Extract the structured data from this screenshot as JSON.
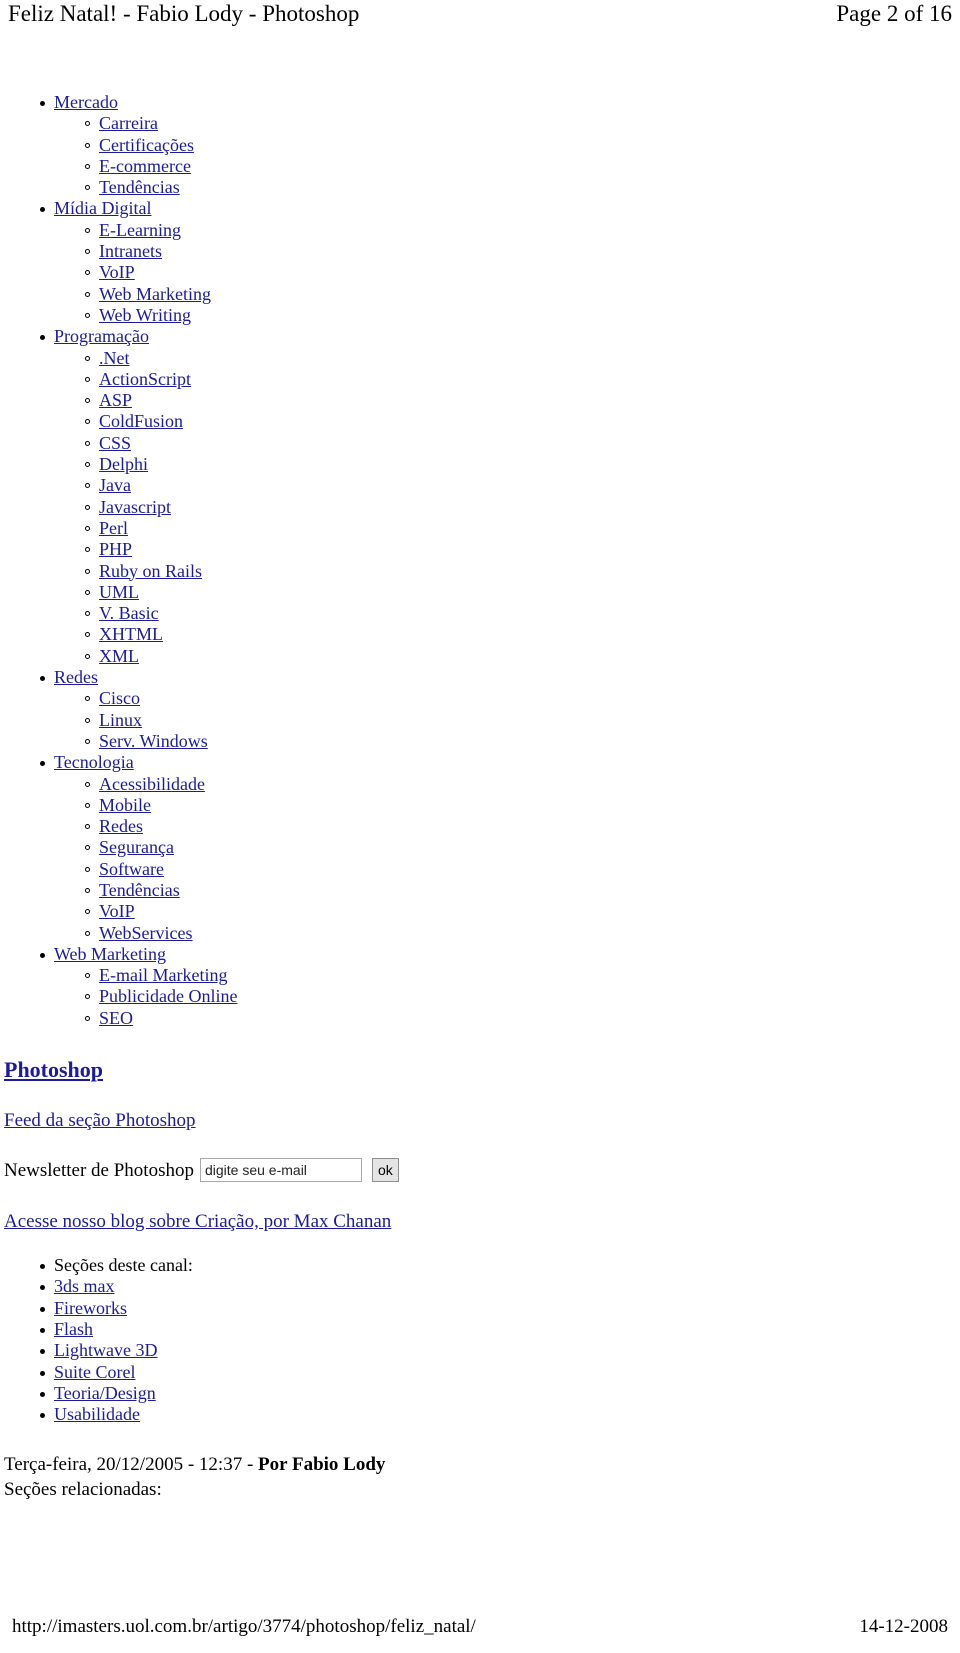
{
  "header": {
    "title": "Feliz Natal! - Fabio Lody - Photoshop",
    "page_indicator": "Page 2 of 16"
  },
  "nav": {
    "groups": [
      {
        "label": "Mercado",
        "children": [
          {
            "label": "Carreira"
          },
          {
            "label": "Certificações"
          },
          {
            "label": "E-commerce"
          },
          {
            "label": "Tendências"
          }
        ]
      },
      {
        "label": "Mídia Digital",
        "children": [
          {
            "label": "E-Learning"
          },
          {
            "label": "Intranets"
          },
          {
            "label": "VoIP"
          },
          {
            "label": "Web Marketing"
          },
          {
            "label": "Web Writing"
          }
        ]
      },
      {
        "label": "Programação",
        "children": [
          {
            "label": ".Net"
          },
          {
            "label": "ActionScript"
          },
          {
            "label": "ASP"
          },
          {
            "label": "ColdFusion"
          },
          {
            "label": "CSS"
          },
          {
            "label": "Delphi"
          },
          {
            "label": "Java"
          },
          {
            "label": "Javascript"
          },
          {
            "label": "Perl"
          },
          {
            "label": "PHP"
          },
          {
            "label": "Ruby on Rails"
          },
          {
            "label": "UML"
          },
          {
            "label": "V. Basic"
          },
          {
            "label": "XHTML"
          },
          {
            "label": "XML"
          }
        ]
      },
      {
        "label": "Redes",
        "children": [
          {
            "label": "Cisco"
          },
          {
            "label": "Linux"
          },
          {
            "label": "Serv. Windows"
          }
        ]
      },
      {
        "label": "Tecnologia",
        "children": [
          {
            "label": "Acessibilidade"
          },
          {
            "label": "Mobile"
          },
          {
            "label": "Redes"
          },
          {
            "label": "Segurança"
          },
          {
            "label": "Software"
          },
          {
            "label": "Tendências"
          },
          {
            "label": "VoIP"
          },
          {
            "label": "WebServices"
          }
        ]
      },
      {
        "label": "Web Marketing",
        "children": [
          {
            "label": "E-mail Marketing"
          },
          {
            "label": "Publicidade Online"
          },
          {
            "label": "SEO"
          }
        ]
      }
    ]
  },
  "section": {
    "heading": "Photoshop",
    "feed_link": "Feed da seção Photoshop"
  },
  "newsletter": {
    "label": "Newsletter de Photoshop",
    "input_value": "digite seu e-mail",
    "input_placeholder": "digite seu e-mail",
    "submit_label": "ok"
  },
  "blog": {
    "link": "Acesse nosso blog sobre Criação, por Max Chanan"
  },
  "channel": {
    "intro": "Seções deste canal:",
    "items": [
      {
        "label": "3ds max"
      },
      {
        "label": "Fireworks"
      },
      {
        "label": "Flash"
      },
      {
        "label": "Lightwave 3D"
      },
      {
        "label": "Suite Corel"
      },
      {
        "label": "Teoria/Design"
      },
      {
        "label": "Usabilidade"
      }
    ]
  },
  "article": {
    "byline_date": "Terça-feira, 20/12/2005 - 12:37 - ",
    "byline_author": "Por Fabio Lody",
    "related_label": "Seções relacionadas:"
  },
  "footer": {
    "url": "http://imasters.uol.com.br/artigo/3774/photoshop/feliz_natal/",
    "date": "14-12-2008"
  },
  "colors": {
    "link": "#1b1b9e",
    "text": "#000000",
    "background": "#ffffff"
  }
}
